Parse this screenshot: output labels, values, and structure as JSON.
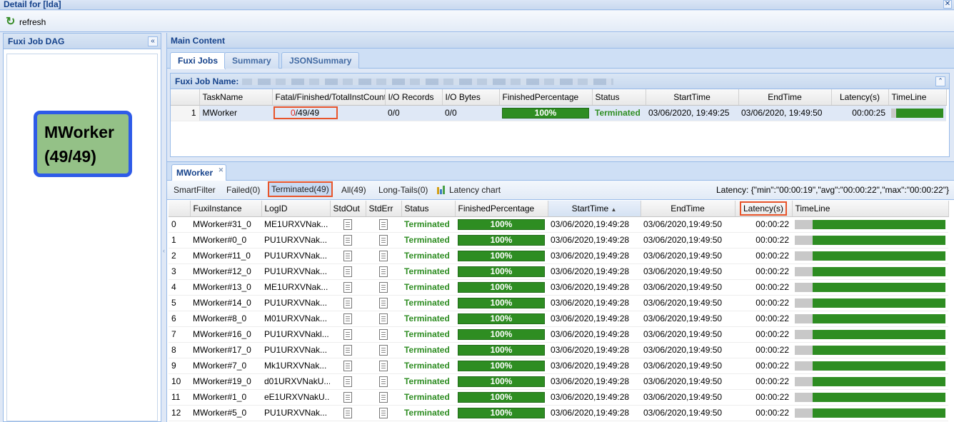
{
  "window": {
    "title": "Detail for [lda]",
    "close": "✕"
  },
  "toolbar": {
    "refresh_label": "refresh"
  },
  "left_panel": {
    "title": "Fuxi Job DAG",
    "collapse": "«"
  },
  "dag": {
    "node_name": "MWorker",
    "node_count": "(49/49)",
    "fill": "#94c187",
    "border": "#2e5be8"
  },
  "main": {
    "title": "Main Content",
    "tabs": [
      {
        "label": "Fuxi Jobs"
      },
      {
        "label": "Summary"
      },
      {
        "label": "JSONSummary"
      }
    ]
  },
  "job_panel": {
    "label": "Fuxi Job Name:",
    "columns": [
      "TaskName",
      "Fatal/Finished/TotalInstCount",
      "I/O Records",
      "I/O Bytes",
      "FinishedPercentage",
      "Status",
      "StartTime",
      "EndTime",
      "Latency(s)",
      "TimeLine"
    ],
    "row": {
      "num": "1",
      "task": "MWorker",
      "fatal": "0",
      "finished_total": "/49/49",
      "io_records": "0/0",
      "io_bytes": "0/0",
      "pct": "100%",
      "pct_value": 100,
      "status": "Terminated",
      "start": "03/06/2020, 19:49:25",
      "end": "03/06/2020,  19:49:50",
      "latency": "00:00:25"
    }
  },
  "worker_panel": {
    "tab": "MWorker",
    "tab_close": "✕",
    "filters": {
      "smart": "SmartFilter",
      "failed": "Failed(0)",
      "terminated": "Terminated(49)",
      "all": "All(49)",
      "longtails": "Long-Tails(0)",
      "chart": "Latency chart"
    },
    "latency_summary": "Latency: {\"min\":\"00:00:19\",\"avg\":\"00:00:22\",\"max\":\"00:00:22\"}",
    "columns": [
      "FuxiInstance",
      "LogID",
      "StdOut",
      "StdErr",
      "Status",
      "FinishedPercentage",
      "StartTime",
      "EndTime",
      "Latency(s)",
      "TimeLine"
    ],
    "rows": [
      {
        "num": "0",
        "inst": "MWorker#31_0",
        "log": "ME1URXVNak...",
        "status": "Terminated",
        "pct": "100%",
        "start": "03/06/2020,19:49:28",
        "end": "03/06/2020,19:49:50",
        "lat": "00:00:22"
      },
      {
        "num": "1",
        "inst": "MWorker#0_0",
        "log": "PU1URXVNak...",
        "status": "Terminated",
        "pct": "100%",
        "start": "03/06/2020,19:49:28",
        "end": "03/06/2020,19:49:50",
        "lat": "00:00:22"
      },
      {
        "num": "2",
        "inst": "MWorker#11_0",
        "log": "PU1URXVNak...",
        "status": "Terminated",
        "pct": "100%",
        "start": "03/06/2020,19:49:28",
        "end": "03/06/2020,19:49:50",
        "lat": "00:00:22"
      },
      {
        "num": "3",
        "inst": "MWorker#12_0",
        "log": "PU1URXVNak...",
        "status": "Terminated",
        "pct": "100%",
        "start": "03/06/2020,19:49:28",
        "end": "03/06/2020,19:49:50",
        "lat": "00:00:22"
      },
      {
        "num": "4",
        "inst": "MWorker#13_0",
        "log": "ME1URXVNak...",
        "status": "Terminated",
        "pct": "100%",
        "start": "03/06/2020,19:49:28",
        "end": "03/06/2020,19:49:50",
        "lat": "00:00:22"
      },
      {
        "num": "5",
        "inst": "MWorker#14_0",
        "log": "PU1URXVNak...",
        "status": "Terminated",
        "pct": "100%",
        "start": "03/06/2020,19:49:28",
        "end": "03/06/2020,19:49:50",
        "lat": "00:00:22"
      },
      {
        "num": "6",
        "inst": "MWorker#8_0",
        "log": "M01URXVNak...",
        "status": "Terminated",
        "pct": "100%",
        "start": "03/06/2020,19:49:28",
        "end": "03/06/2020,19:49:50",
        "lat": "00:00:22"
      },
      {
        "num": "7",
        "inst": "MWorker#16_0",
        "log": "PU1URXVNakl...",
        "status": "Terminated",
        "pct": "100%",
        "start": "03/06/2020,19:49:28",
        "end": "03/06/2020,19:49:50",
        "lat": "00:00:22"
      },
      {
        "num": "8",
        "inst": "MWorker#17_0",
        "log": "PU1URXVNak...",
        "status": "Terminated",
        "pct": "100%",
        "start": "03/06/2020,19:49:28",
        "end": "03/06/2020,19:49:50",
        "lat": "00:00:22"
      },
      {
        "num": "9",
        "inst": "MWorker#7_0",
        "log": "Mk1URXVNak...",
        "status": "Terminated",
        "pct": "100%",
        "start": "03/06/2020,19:49:28",
        "end": "03/06/2020,19:49:50",
        "lat": "00:00:22"
      },
      {
        "num": "10",
        "inst": "MWorker#19_0",
        "log": "d01URXVNakU...",
        "status": "Terminated",
        "pct": "100%",
        "start": "03/06/2020,19:49:28",
        "end": "03/06/2020,19:49:50",
        "lat": "00:00:22"
      },
      {
        "num": "11",
        "inst": "MWorker#1_0",
        "log": "eE1URXVNakU...",
        "status": "Terminated",
        "pct": "100%",
        "start": "03/06/2020,19:49:28",
        "end": "03/06/2020,19:49:50",
        "lat": "00:00:22"
      },
      {
        "num": "12",
        "inst": "MWorker#5_0",
        "log": "PU1URXVNak...",
        "status": "Terminated",
        "pct": "100%",
        "start": "03/06/2020,19:49:28",
        "end": "03/06/2020,19:49:50",
        "lat": "00:00:22"
      }
    ]
  }
}
